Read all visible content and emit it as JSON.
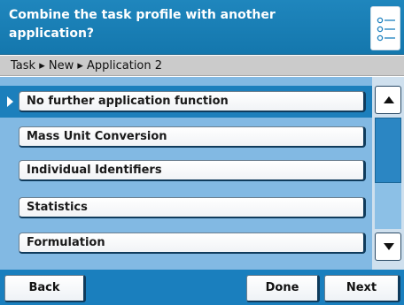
{
  "header": {
    "title": "Combine the task profile with another application?",
    "icon": "list-icon"
  },
  "breadcrumb": {
    "text": "Task ▸ New ▸ Application 2"
  },
  "options": [
    {
      "label": "No further application function",
      "selected": true
    },
    {
      "label": "Mass Unit Conversion",
      "selected": false
    },
    {
      "label": "Individual Identifiers",
      "selected": false
    },
    {
      "label": "Statistics",
      "selected": false
    },
    {
      "label": "Formulation",
      "selected": false
    }
  ],
  "scrollbar": {
    "up_icon": "arrow-up-icon",
    "down_icon": "arrow-down-icon"
  },
  "footer": {
    "back_label": "Back",
    "done_label": "Done",
    "next_label": "Next"
  },
  "colors": {
    "header_blue": "#1a7fbe",
    "list_background": "#82b9e3",
    "selection_strip": "#1c7fbc",
    "breadcrumb_gray": "#cbcbcb"
  }
}
